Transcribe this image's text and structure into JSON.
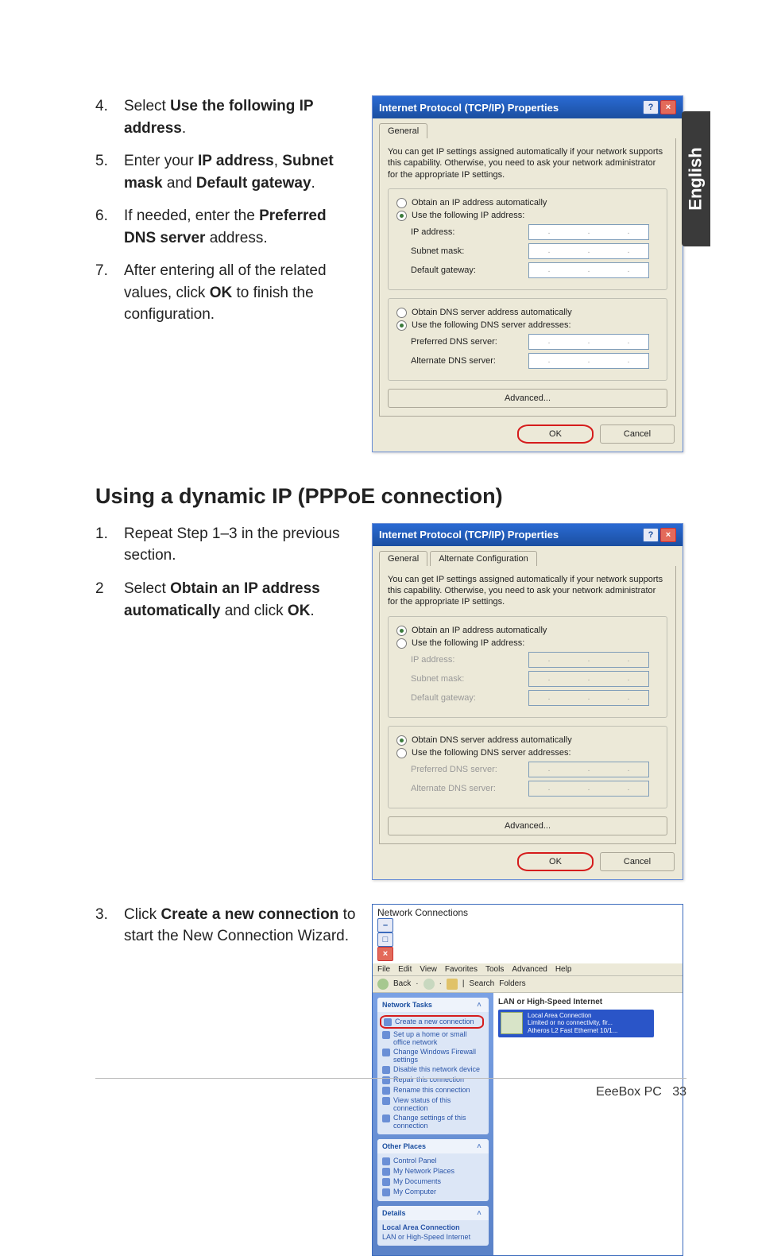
{
  "side_tab": "English",
  "static_steps": [
    {
      "num": "4.",
      "parts": [
        "Select ",
        {
          "b": "Use the following IP address"
        },
        "."
      ]
    },
    {
      "num": "5.",
      "parts": [
        "Enter your ",
        {
          "b": "IP address"
        },
        ", ",
        {
          "b": "Subnet mask"
        },
        " and ",
        {
          "b": "Default gateway"
        },
        "."
      ]
    },
    {
      "num": "6.",
      "parts": [
        "If needed, enter the ",
        {
          "b": "Preferred DNS server"
        },
        " address."
      ]
    },
    {
      "num": "7.",
      "parts": [
        "After entering all of the related values, click ",
        {
          "b": "OK"
        },
        " to finish the configuration."
      ]
    }
  ],
  "section_heading": "Using a dynamic IP (PPPoE connection)",
  "dynamic_steps": [
    {
      "num": "1.",
      "parts": [
        "Repeat Step 1–3 in the previous section."
      ]
    },
    {
      "num": "2",
      "parts": [
        "Select ",
        {
          "b": "Obtain an IP address automatically"
        },
        " and click ",
        {
          "b": "OK"
        },
        "."
      ]
    }
  ],
  "wizard_step": {
    "num": "3.",
    "parts": [
      "Click ",
      {
        "b": "Create a new connection"
      },
      " to start the New Connection Wizard."
    ]
  },
  "dialog": {
    "title": "Internet Protocol (TCP/IP) Properties",
    "help_btn": "?",
    "close_btn": "×",
    "tabs": {
      "general": "General",
      "alternate": "Alternate Configuration"
    },
    "desc": "You can get IP settings assigned automatically if your network supports this capability. Otherwise, you need to ask your network administrator for the appropriate IP settings.",
    "radio_auto_ip": "Obtain an IP address automatically",
    "radio_use_ip": "Use the following IP address:",
    "ip_label": "IP address:",
    "subnet_label": "Subnet mask:",
    "gateway_label": "Default gateway:",
    "radio_auto_dns": "Obtain DNS server address automatically",
    "radio_use_dns": "Use the following DNS server addresses:",
    "pref_dns_label": "Preferred DNS server:",
    "alt_dns_label": "Alternate DNS server:",
    "advanced_btn": "Advanced...",
    "ok_btn": "OK",
    "cancel_btn": "Cancel"
  },
  "ncwin": {
    "title": "Network Connections",
    "minimize_btn": "–",
    "maximize_btn": "□",
    "close_btn": "×",
    "menu": [
      "File",
      "Edit",
      "View",
      "Favorites",
      "Tools",
      "Advanced",
      "Help"
    ],
    "toolbar": {
      "back": "Back",
      "search": "Search",
      "folders": "Folders"
    },
    "section_lan": "LAN or High-Speed Internet",
    "lan_item": {
      "name": "Local Area Connection",
      "status": "Limited or no connectivity, fir...",
      "device": "Atheros L2 Fast Ethernet 10/1..."
    },
    "panels": {
      "tasks_title": "Network Tasks",
      "tasks": [
        "Create a new connection",
        "Set up a home or small office network",
        "Change Windows Firewall settings",
        "Disable this network device",
        "Repair this connection",
        "Rename this connection",
        "View status of this connection",
        "Change settings of this connection"
      ],
      "other_title": "Other Places",
      "other": [
        "Control Panel",
        "My Network Places",
        "My Documents",
        "My Computer"
      ],
      "details_title": "Details",
      "details": [
        "Local Area Connection",
        "LAN or High-Speed Internet"
      ]
    }
  },
  "footer": {
    "product": "EeeBox PC",
    "page": "33"
  }
}
